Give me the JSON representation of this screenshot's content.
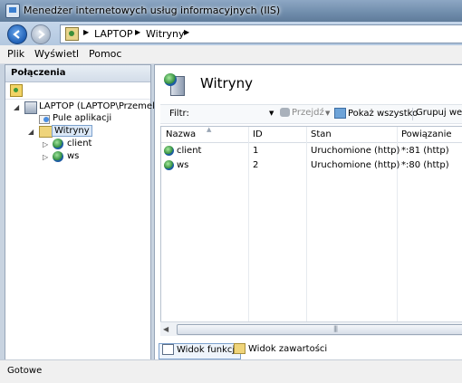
{
  "window": {
    "title": "Menedżer internetowych usług informacyjnych (IIS)"
  },
  "address": {
    "breadcrumb": [
      "LAPTOP",
      "Witryny"
    ]
  },
  "menu": [
    "Plik",
    "Wyświetl",
    "Pomoc"
  ],
  "connections": {
    "header": "Połączenia",
    "tree": {
      "server": "LAPTOP (LAPTOP\\Przemek)",
      "app_pools": "Pule aplikacji",
      "sites": "Witryny",
      "site_client": "client",
      "site_ws": "ws"
    }
  },
  "main": {
    "title": "Witryny",
    "filter_label": "Filtr:",
    "go_label": "Przejdź",
    "show_all_label": "Pokaż wszystko",
    "group_label": "Grupuj wedł",
    "columns": [
      "Nazwa",
      "ID",
      "Stan",
      "Powiązanie"
    ],
    "rows": [
      {
        "name": "client",
        "id": "1",
        "state": "Uruchomione (http)",
        "binding": "*:81 (http)"
      },
      {
        "name": "ws",
        "id": "2",
        "state": "Uruchomione (http)",
        "binding": "*:80 (http)"
      }
    ],
    "view_tabs": {
      "features": "Widok funkcji",
      "contents": "Widok zawartości"
    }
  },
  "status": {
    "text": "Gotowe"
  }
}
